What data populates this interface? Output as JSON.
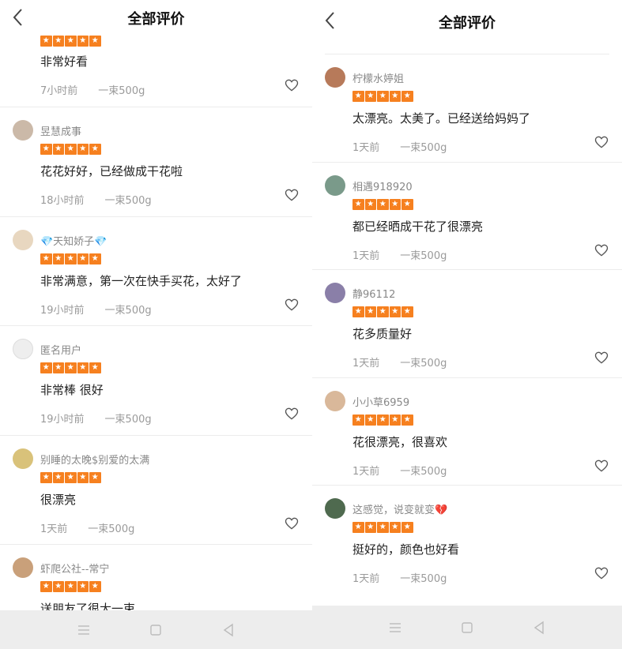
{
  "screens": [
    {
      "title": "全部评价",
      "partial_top": {
        "content": "非常好看",
        "time": "7小时前",
        "spec": "一束500g"
      },
      "reviews": [
        {
          "name": "昱慧成事",
          "content": "花花好好，已经做成干花啦",
          "time": "18小时前",
          "spec": "一束500g"
        },
        {
          "name": "💎天知娇子💎",
          "content": "非常满意，第一次在快手买花，太好了",
          "time": "19小时前",
          "spec": "一束500g"
        },
        {
          "name": "匿名用户",
          "content": "非常棒 很好",
          "time": "19小时前",
          "spec": "一束500g"
        },
        {
          "name": "别睡的太晚$别爱的太满",
          "content": "很漂亮",
          "time": "1天前",
          "spec": "一束500g"
        },
        {
          "name": "虾爬公社--常宁",
          "content": "送朋友了很大一束",
          "time": "",
          "spec": ""
        }
      ]
    },
    {
      "title": "全部评价",
      "reviews": [
        {
          "name": "柠檬水婷姐",
          "content": "太漂亮。太美了。已经送给妈妈了",
          "time": "1天前",
          "spec": "一束500g"
        },
        {
          "name": "相遇918920",
          "content": "都已经晒成干花了很漂亮",
          "time": "1天前",
          "spec": "一束500g"
        },
        {
          "name": "静96112",
          "content": "花多质量好",
          "time": "1天前",
          "spec": "一束500g"
        },
        {
          "name": "小小草6959",
          "content": "花很漂亮，很喜欢",
          "time": "1天前",
          "spec": "一束500g"
        },
        {
          "name": "这感觉，说变就变💔",
          "content": "挺好的，颜色也好看",
          "time": "1天前",
          "spec": "一束500g"
        }
      ]
    }
  ],
  "icons": {
    "back": "chevron-left-icon",
    "like": "heart-outline-icon",
    "star": "star-icon",
    "nav": [
      "menu-icon",
      "home-square-icon",
      "back-triangle-icon"
    ]
  },
  "colors": {
    "star": "#f6801f",
    "navbar": "#ededed",
    "text_secondary": "#888888"
  }
}
